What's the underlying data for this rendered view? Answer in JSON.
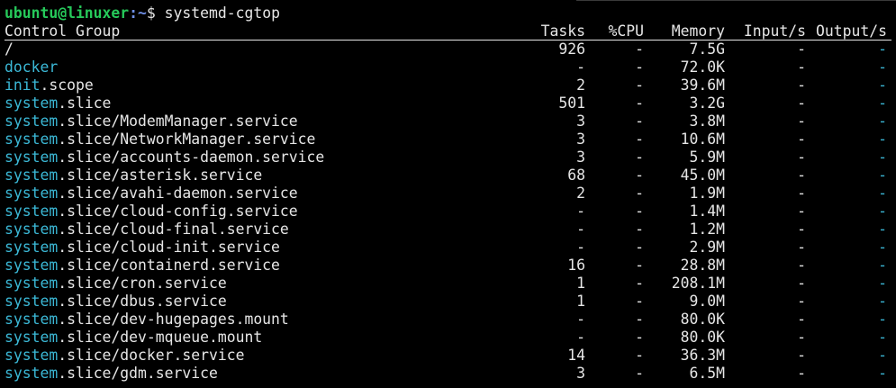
{
  "prompt": {
    "user_host": "ubuntu@linuxer",
    "path": ":~",
    "symbol": "$ ",
    "command": "systemd-cgtop"
  },
  "columns": {
    "group": "Control Group",
    "tasks": "Tasks",
    "cpu": "%CPU",
    "memory": "Memory",
    "input": "Input/s",
    "output": "Output/s"
  },
  "rows": [
    {
      "prefix": "",
      "suffix": "/",
      "tasks": "926",
      "cpu": "-",
      "memory": "7.5G",
      "input": "-",
      "output": "-"
    },
    {
      "prefix": "docker",
      "suffix": "",
      "tasks": "-",
      "cpu": "-",
      "memory": "72.0K",
      "input": "-",
      "output": "-"
    },
    {
      "prefix": "init",
      "suffix": ".scope",
      "tasks": "2",
      "cpu": "-",
      "memory": "39.6M",
      "input": "-",
      "output": "-"
    },
    {
      "prefix": "system",
      "suffix": ".slice",
      "tasks": "501",
      "cpu": "-",
      "memory": "3.2G",
      "input": "-",
      "output": "-"
    },
    {
      "prefix": "system",
      "suffix": ".slice/ModemManager.service",
      "tasks": "3",
      "cpu": "-",
      "memory": "3.8M",
      "input": "-",
      "output": "-"
    },
    {
      "prefix": "system",
      "suffix": ".slice/NetworkManager.service",
      "tasks": "3",
      "cpu": "-",
      "memory": "10.6M",
      "input": "-",
      "output": "-"
    },
    {
      "prefix": "system",
      "suffix": ".slice/accounts-daemon.service",
      "tasks": "3",
      "cpu": "-",
      "memory": "5.9M",
      "input": "-",
      "output": "-"
    },
    {
      "prefix": "system",
      "suffix": ".slice/asterisk.service",
      "tasks": "68",
      "cpu": "-",
      "memory": "45.0M",
      "input": "-",
      "output": "-"
    },
    {
      "prefix": "system",
      "suffix": ".slice/avahi-daemon.service",
      "tasks": "2",
      "cpu": "-",
      "memory": "1.9M",
      "input": "-",
      "output": "-"
    },
    {
      "prefix": "system",
      "suffix": ".slice/cloud-config.service",
      "tasks": "-",
      "cpu": "-",
      "memory": "1.4M",
      "input": "-",
      "output": "-"
    },
    {
      "prefix": "system",
      "suffix": ".slice/cloud-final.service",
      "tasks": "-",
      "cpu": "-",
      "memory": "1.2M",
      "input": "-",
      "output": "-"
    },
    {
      "prefix": "system",
      "suffix": ".slice/cloud-init.service",
      "tasks": "-",
      "cpu": "-",
      "memory": "2.9M",
      "input": "-",
      "output": "-"
    },
    {
      "prefix": "system",
      "suffix": ".slice/containerd.service",
      "tasks": "16",
      "cpu": "-",
      "memory": "28.8M",
      "input": "-",
      "output": "-"
    },
    {
      "prefix": "system",
      "suffix": ".slice/cron.service",
      "tasks": "1",
      "cpu": "-",
      "memory": "208.1M",
      "input": "-",
      "output": "-"
    },
    {
      "prefix": "system",
      "suffix": ".slice/dbus.service",
      "tasks": "1",
      "cpu": "-",
      "memory": "9.0M",
      "input": "-",
      "output": "-"
    },
    {
      "prefix": "system",
      "suffix": ".slice/dev-hugepages.mount",
      "tasks": "-",
      "cpu": "-",
      "memory": "80.0K",
      "input": "-",
      "output": "-"
    },
    {
      "prefix": "system",
      "suffix": ".slice/dev-mqueue.mount",
      "tasks": "-",
      "cpu": "-",
      "memory": "80.0K",
      "input": "-",
      "output": "-"
    },
    {
      "prefix": "system",
      "suffix": ".slice/docker.service",
      "tasks": "14",
      "cpu": "-",
      "memory": "36.3M",
      "input": "-",
      "output": "-"
    },
    {
      "prefix": "system",
      "suffix": ".slice/gdm.service",
      "tasks": "3",
      "cpu": "-",
      "memory": "6.5M",
      "input": "-",
      "output": "-"
    }
  ],
  "colors": {
    "background": "#000000",
    "text": "#e6e6e6",
    "prompt_user": "#26c95a",
    "prompt_path": "#6f8fe6",
    "cgroup_name": "#3bb8d6",
    "output_dash": "#3bb8d6"
  }
}
